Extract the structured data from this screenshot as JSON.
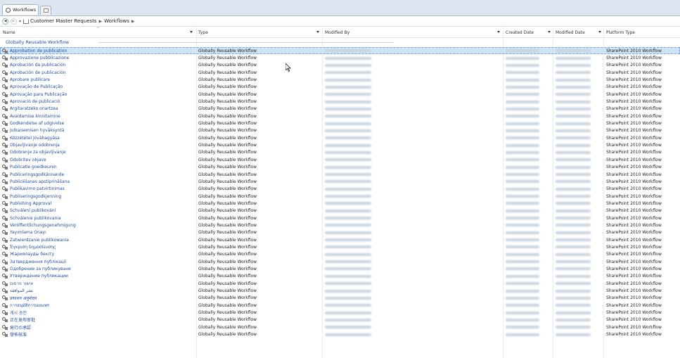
{
  "tab": {
    "label": "Workflows"
  },
  "breadcrumb": [
    "Customer Master Requests",
    "Workflows"
  ],
  "columns": [
    "Name",
    "Type",
    "Modified By",
    "Created Date",
    "Modified Date",
    "Platform Type"
  ],
  "group": {
    "label": "Globally Reusable Workflow"
  },
  "type_value": "Globally Reusable Workflow",
  "platform_value": "SharePoint 2010 Workflow",
  "rows": [
    "Approbation de publication",
    "Approvazione pubblicazione",
    "Aprobación da publicación",
    "Aprobación de publicación",
    "Aprobare publicare",
    "Aprovação de Publicação",
    "Aprovação para Publicação",
    "Aprovació de publicació",
    "Argitaratzeko onartzea",
    "Avaldamise kinnitamine",
    "Godkendelse af udgivelse",
    "Julkaisemisen hyväksyntä",
    "Közzététel jóváhagyása",
    "Objavljivanje odobrenja",
    "Odobrenje za objavljivanje",
    "Odobritev objave",
    "Publicatie goedkeuren",
    "Publiceringsgodkännande",
    "Publicēšanas apstiprināšana",
    "Publikavimo patvirtinimas",
    "Publiseringsgodkjenning",
    "Publishing Approval",
    "Schválení publikování",
    "Schválenie publikovania",
    "Veröffentlichungsgenehmigung",
    "Yayımlama Onayı",
    "Zatwierdzanie publikowania",
    "Έγκριση δημοσίευσης",
    "Жариялауды бекіту",
    "Затвердження публікації",
    "Одобрение за публикуване",
    "Утверждение публикации",
    "אישור פרסום",
    "نشر الموافقة",
    "प्रकाशन अनुमोदन",
    "การอนุมัติการเผยแพร่",
    "게시 승인",
    "正在发布审批",
    "発行の承認",
    "發佈核准"
  ]
}
